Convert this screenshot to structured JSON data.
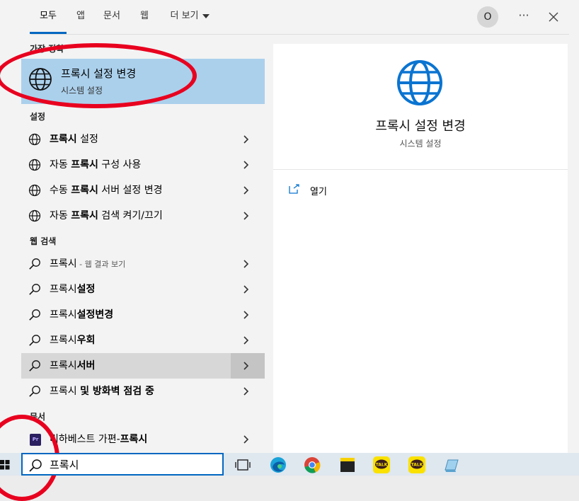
{
  "tabs": [
    {
      "label": "모두"
    },
    {
      "label": "앱"
    },
    {
      "label": "문서"
    },
    {
      "label": "웹"
    },
    {
      "label": "더 보기"
    }
  ],
  "user_initial": "O",
  "more_label": "···",
  "best_match": {
    "section": "가장 정확",
    "title": "프록시 설정 변경",
    "subtitle": "시스템 설정"
  },
  "settings": {
    "section": "설정",
    "items": [
      {
        "pre": "",
        "bold": "프록시",
        "post": " 설정"
      },
      {
        "pre": "자동 ",
        "bold": "프록시",
        "post": " 구성 사용"
      },
      {
        "pre": "수동 ",
        "bold": "프록시",
        "post": " 서버 설정 변경"
      },
      {
        "pre": "자동 ",
        "bold": "프록시",
        "post": " 검색 켜기/끄기"
      }
    ]
  },
  "web": {
    "section": "웹 검색",
    "items": [
      {
        "pre": "프록시",
        "bold": "",
        "post": "",
        "sub": " - 웹 결과 보기"
      },
      {
        "pre": "프록시",
        "bold": "설정",
        "post": "",
        "sub": ""
      },
      {
        "pre": "프록시",
        "bold": "설정변경",
        "post": "",
        "sub": ""
      },
      {
        "pre": "프록시",
        "bold": "우회",
        "post": "",
        "sub": ""
      },
      {
        "pre": "프록시",
        "bold": "서버",
        "post": "",
        "sub": ""
      },
      {
        "pre": "프록시 ",
        "bold": "및 방화벽 점검 중",
        "post": "",
        "sub": ""
      }
    ]
  },
  "documents": {
    "section": "문서",
    "items": [
      {
        "pre": "리하베스트 가편-",
        "bold": "",
        "post": "프록시",
        "icon_text": "Pr"
      }
    ]
  },
  "preview": {
    "title": "프록시 설정 변경",
    "subtitle": "시스템 설정",
    "open_label": "열기"
  },
  "search": {
    "value": "프록시"
  },
  "taskbar": {
    "apps": [
      "task-view",
      "edge",
      "chrome",
      "sticky-notes",
      "kakaotalk",
      "kakaotalk",
      "notepad"
    ]
  },
  "colors": {
    "accent": "#0067c0",
    "highlight": "#abd0ec",
    "annotation": "#e8001f"
  }
}
